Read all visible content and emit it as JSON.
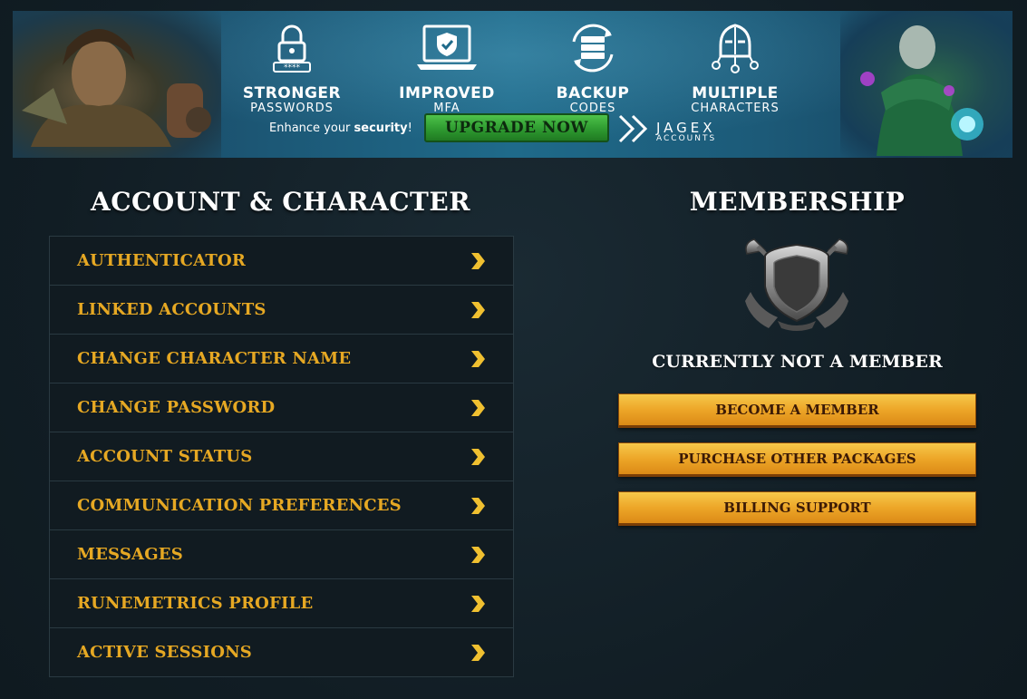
{
  "banner": {
    "features": [
      {
        "icon": "padlock-password-icon",
        "line1": "STRONGER",
        "line2": "PASSWORDS"
      },
      {
        "icon": "laptop-shield-icon",
        "line1": "IMPROVED",
        "line2": "MFA"
      },
      {
        "icon": "backup-codes-icon",
        "line1": "BACKUP",
        "line2": "CODES"
      },
      {
        "icon": "helmet-characters-icon",
        "line1": "MULTIPLE",
        "line2": "CHARACTERS"
      }
    ],
    "enhance_prefix": "Enhance your ",
    "enhance_bold": "security",
    "enhance_suffix": "!",
    "upgrade_label": "UPGRADE NOW",
    "brand_word": "JAGEX",
    "brand_sub": "ACCOUNTS"
  },
  "account": {
    "heading": "ACCOUNT & CHARACTER",
    "items": [
      {
        "label": "AUTHENTICATOR"
      },
      {
        "label": "LINKED ACCOUNTS"
      },
      {
        "label": "CHANGE CHARACTER NAME"
      },
      {
        "label": "CHANGE PASSWORD"
      },
      {
        "label": "ACCOUNT STATUS"
      },
      {
        "label": "COMMUNICATION PREFERENCES"
      },
      {
        "label": "MESSAGES"
      },
      {
        "label": "RUNEMETRICS PROFILE"
      },
      {
        "label": "ACTIVE SESSIONS"
      }
    ]
  },
  "membership": {
    "heading": "MEMBERSHIP",
    "status": "CURRENTLY NOT A MEMBER",
    "buttons": [
      {
        "label": "BECOME A MEMBER"
      },
      {
        "label": "PURCHASE OTHER PACKAGES"
      },
      {
        "label": "BILLING SUPPORT"
      }
    ]
  },
  "colors": {
    "accent_gold": "#e6a823",
    "upgrade_green": "#2e9a30",
    "background": "#132027"
  }
}
